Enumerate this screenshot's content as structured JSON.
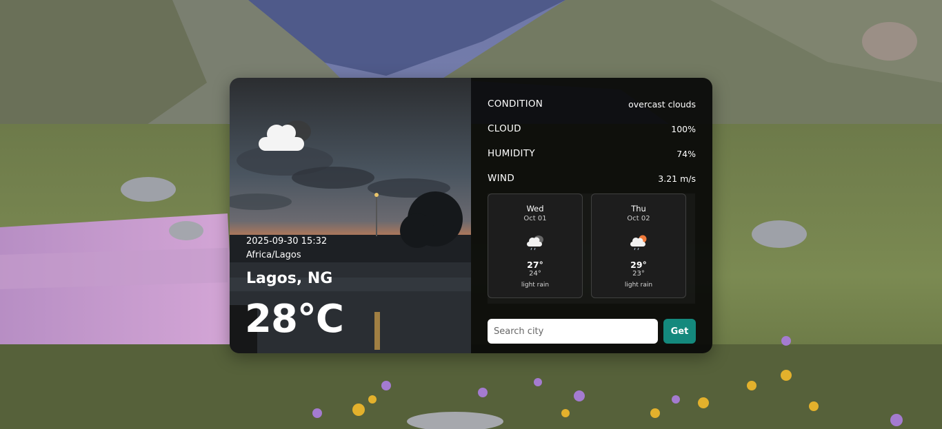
{
  "location": {
    "datetime": "2025-09-30 15:32",
    "timezone": "Africa/Lagos",
    "city": "Lagos, NG",
    "temperature": "28°C",
    "icon": "cloud-icon"
  },
  "details": [
    {
      "label": "CONDITION",
      "value": "overcast clouds"
    },
    {
      "label": "CLOUD",
      "value": "100%"
    },
    {
      "label": "HUMIDITY",
      "value": "74%"
    },
    {
      "label": "WIND",
      "value": "3.21 m/s"
    }
  ],
  "forecast": [
    {
      "day": "Wed",
      "date": "Oct 01",
      "high": "27°",
      "low": "24°",
      "description": "light rain",
      "icon": "rain-cloud-icon"
    },
    {
      "day": "Thu",
      "date": "Oct 02",
      "high": "29°",
      "low": "23°",
      "description": "light rain",
      "icon": "sun-rain-cloud-icon"
    }
  ],
  "search": {
    "placeholder": "Search city",
    "value": "",
    "button_label": "Get"
  },
  "colors": {
    "accent": "#14897d",
    "panel": "#080808"
  }
}
